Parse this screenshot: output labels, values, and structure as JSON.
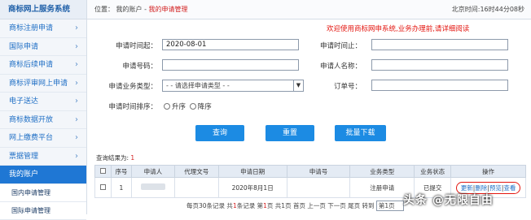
{
  "sidebar": {
    "title": "商标网上服务系统",
    "items": [
      {
        "label": "商标注册申请"
      },
      {
        "label": "国际申请"
      },
      {
        "label": "商标后续申请"
      },
      {
        "label": "商标评审网上申请"
      },
      {
        "label": "电子送达"
      },
      {
        "label": "商标数据开放"
      },
      {
        "label": "网上缴费平台"
      },
      {
        "label": "票据管理"
      }
    ],
    "active_item": "我的账户",
    "sub_items": [
      {
        "label": "国内申请管理"
      },
      {
        "label": "国际申请管理"
      }
    ],
    "chevron": "›"
  },
  "header": {
    "breadcrumb_prefix": "位置： 我的账户 - ",
    "breadcrumb_current": "我的申请管理",
    "clock": "北京时间:16时44分08秒"
  },
  "welcome": "欢迎使用商标网申系统,业务办理前,请详细阅读",
  "form": {
    "start_label": "申请时间起：",
    "start_value": "2020-08-01",
    "end_label": "申请时间止：",
    "end_value": "",
    "number_label": "申请号码：",
    "applicant_label": "申请人名称：",
    "type_label": "申请业务类型：",
    "type_value": "- - 请选择申请类型 - -",
    "order_label": "订单号：",
    "sort_label": "申请时间排序：",
    "sort_asc": "升序",
    "sort_desc": "降序"
  },
  "buttons": {
    "query": "查询",
    "reset": "重置",
    "batch_download": "批量下载"
  },
  "results": {
    "count_label": "查询结果为: ",
    "count_value": "1"
  },
  "table": {
    "headers": [
      "",
      "序号",
      "申请人",
      "代理文号",
      "申请日期",
      "申请号",
      "业务类型",
      "业务状态",
      "操作"
    ],
    "rows": [
      {
        "index": "1",
        "applicant": "",
        "agent_no": "",
        "date": "2020年8月1日",
        "app_no": "",
        "type": "注册申请",
        "status": "已提交",
        "ops": [
          "更新",
          "删除",
          "预览",
          "查看"
        ]
      }
    ]
  },
  "pager": {
    "per_page_a": "每页",
    "per_page_n": "30",
    "per_page_b": "条记录 共",
    "total_n": "1",
    "total_b": "条记录 第",
    "page_n": "1",
    "page_b": "页 共",
    "pages_n": "1",
    "pages_b": "页 首页 上一页 下一页 尾页 转到",
    "goto_value": "第1页"
  },
  "watermark": "头条 @无限自由",
  "colors": {
    "accent": "#1c8be3",
    "highlight": "#e3150f",
    "active_nav": "#1f77d4"
  }
}
